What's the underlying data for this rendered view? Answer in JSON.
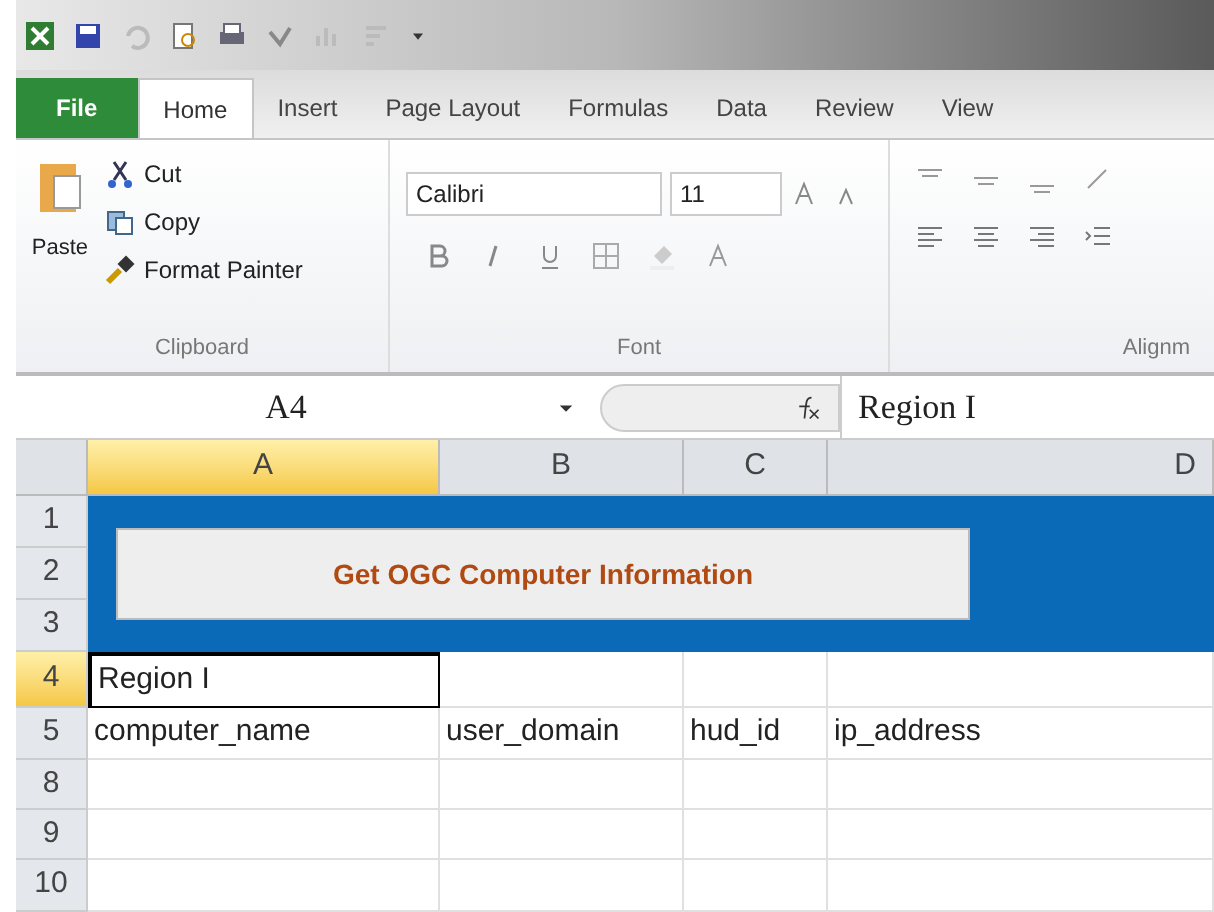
{
  "tabs": [
    {
      "label": "File",
      "kind": "file",
      "selected": false
    },
    {
      "label": "Home",
      "kind": "tab",
      "selected": true
    },
    {
      "label": "Insert",
      "kind": "tab",
      "selected": false
    },
    {
      "label": "Page Layout",
      "kind": "tab",
      "selected": false
    },
    {
      "label": "Formulas",
      "kind": "tab",
      "selected": false
    },
    {
      "label": "Data",
      "kind": "tab",
      "selected": false
    },
    {
      "label": "Review",
      "kind": "tab",
      "selected": false
    },
    {
      "label": "View",
      "kind": "tab",
      "selected": false
    }
  ],
  "clipboard": {
    "paste": "Paste",
    "cut": "Cut",
    "copy": "Copy",
    "format_painter": "Format Painter",
    "label": "Clipboard"
  },
  "font": {
    "name": "Calibri",
    "size": "11",
    "label": "Font"
  },
  "alignment": {
    "label": "Alignm"
  },
  "formula_bar": {
    "name_box": "A4",
    "formula": "Region I"
  },
  "columns": [
    {
      "label": "A",
      "selected": true
    },
    {
      "label": "B",
      "selected": false
    },
    {
      "label": "C",
      "selected": false
    },
    {
      "label": "D",
      "selected": false
    }
  ],
  "macro_button": {
    "label": "Get OGC Computer Information"
  },
  "banner_rows": [
    {
      "number": "1",
      "selected": false
    },
    {
      "number": "2",
      "selected": false
    },
    {
      "number": "3",
      "selected": false
    }
  ],
  "rows": [
    {
      "number": "4",
      "selected": true,
      "cells": [
        "Region I",
        "",
        "",
        ""
      ]
    },
    {
      "number": "5",
      "selected": false,
      "cells": [
        "computer_name",
        "user_domain",
        "hud_id",
        "ip_address"
      ]
    },
    {
      "number": "8",
      "selected": false,
      "cells": [
        "",
        "",
        "",
        ""
      ]
    },
    {
      "number": "9",
      "selected": false,
      "cells": [
        "",
        "",
        "",
        ""
      ]
    },
    {
      "number": "10",
      "selected": false,
      "cells": [
        "",
        "",
        "",
        ""
      ]
    }
  ]
}
